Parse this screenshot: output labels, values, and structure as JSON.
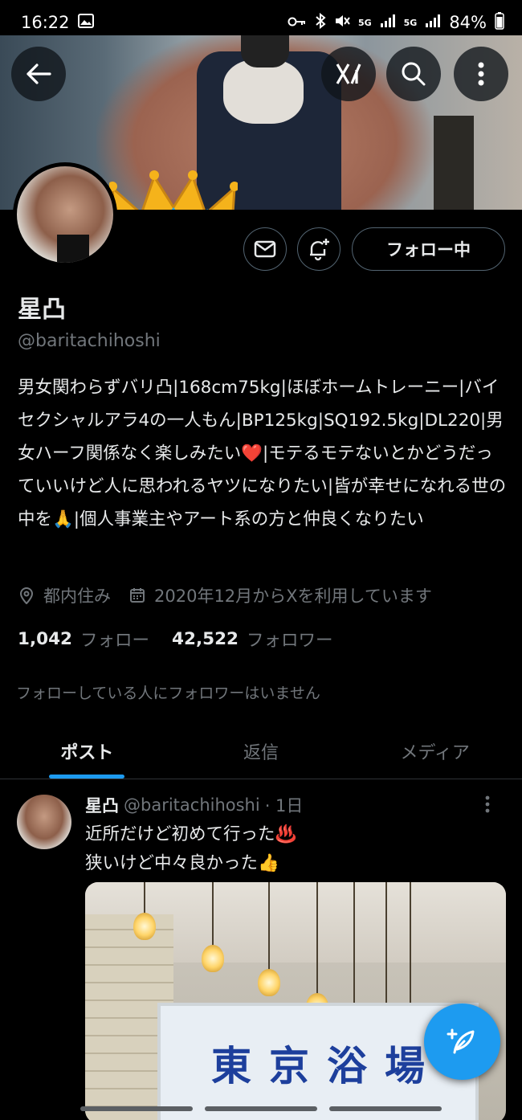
{
  "status_bar": {
    "time": "16:22",
    "network": "5G",
    "battery": "84%"
  },
  "profile": {
    "display_name": "星凸",
    "handle": "@baritachihoshi",
    "bio": "男女関わらずバリ凸|168cm75kg|ほぼホームトレーニー|バイセクシャルアラ4の一人もん|BP125kg|SQ192.5kg|DL220|男女ハーフ関係なく楽しみたい❤️|モテるモテないとかどうだっていいけど人に思われるヤツになりたい|皆が幸せになれる世の中を🙏|個人事業主やアート系の方と仲良くなりたい",
    "location": "都内住み",
    "joined": "2020年12月からXを利用しています",
    "following_count": "1,042",
    "following_label": "フォロー",
    "followers_count": "42,522",
    "followers_label": "フォロワー",
    "mutual_note": "フォローしている人にフォロワーはいません",
    "follow_button_label": "フォロー中"
  },
  "tabs": [
    {
      "label": "ポスト",
      "active": true
    },
    {
      "label": "返信",
      "active": false
    },
    {
      "label": "メディア",
      "active": false
    }
  ],
  "post": {
    "name": "星凸",
    "handle": "@baritachihoshi",
    "time": "· 1日",
    "line1": "近所だけど初めて行った♨️",
    "line2": "狭いけど中々良かった👍",
    "image_sign": [
      "東",
      "京",
      "浴",
      "場"
    ]
  },
  "icons": {
    "back": "back-arrow-icon",
    "grok": "grok-icon",
    "search": "search-icon",
    "more": "more-vertical-icon",
    "message": "envelope-icon",
    "notify": "bell-plus-icon",
    "location": "location-pin-icon",
    "calendar": "calendar-icon",
    "compose": "compose-feather-icon"
  },
  "colors": {
    "accent": "#1d9bf0",
    "background": "#000000",
    "text_primary": "#e7e9ea",
    "text_secondary": "#71767b",
    "border": "#2f3336"
  }
}
